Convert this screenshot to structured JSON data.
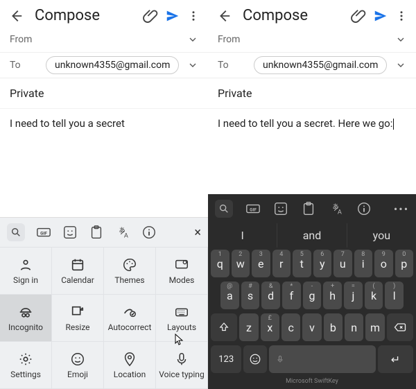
{
  "left": {
    "header": {
      "title": "Compose"
    },
    "from_label": "From",
    "to_label": "To",
    "to_value": "unknown4355@gmail.com",
    "subject": "Private",
    "body": "I need to tell you a secret",
    "kb": {
      "grid": [
        {
          "label": "Sign in",
          "icon": "person"
        },
        {
          "label": "Calendar",
          "icon": "calendar"
        },
        {
          "label": "Themes",
          "icon": "palette"
        },
        {
          "label": "Modes",
          "icon": "modes"
        },
        {
          "label": "Incognito",
          "icon": "incognito",
          "selected": true
        },
        {
          "label": "Resize",
          "icon": "resize"
        },
        {
          "label": "Autocorrect",
          "icon": "autocorrect"
        },
        {
          "label": "Layouts",
          "icon": "keyboard"
        },
        {
          "label": "Settings",
          "icon": "gear"
        },
        {
          "label": "Emoji",
          "icon": "emoji"
        },
        {
          "label": "Location",
          "icon": "pin"
        },
        {
          "label": "Voice typing",
          "icon": "mic"
        }
      ]
    }
  },
  "right": {
    "header": {
      "title": "Compose"
    },
    "from_label": "From",
    "to_label": "To",
    "to_value": "unknown4355@gmail.com",
    "subject": "Private",
    "body": "I need to tell you a secret. Here we go:",
    "kb": {
      "suggestions": [
        "I",
        "and",
        "you"
      ],
      "rows": [
        [
          {
            "k": "q",
            "a": "1"
          },
          {
            "k": "w",
            "a": "2"
          },
          {
            "k": "e",
            "a": "3"
          },
          {
            "k": "r",
            "a": "4"
          },
          {
            "k": "t",
            "a": "5"
          },
          {
            "k": "y",
            "a": "6"
          },
          {
            "k": "u",
            "a": "7"
          },
          {
            "k": "i",
            "a": "8"
          },
          {
            "k": "o",
            "a": "9"
          },
          {
            "k": "p",
            "a": "0"
          }
        ],
        [
          {
            "k": "a",
            "a": "@"
          },
          {
            "k": "s",
            "a": "#"
          },
          {
            "k": "d",
            "a": "&"
          },
          {
            "k": "f",
            "a": "*"
          },
          {
            "k": "g",
            "a": "-"
          },
          {
            "k": "h",
            "a": "+"
          },
          {
            "k": "j",
            "a": "="
          },
          {
            "k": "k",
            "a": "("
          },
          {
            "k": "l",
            "a": ")"
          }
        ],
        [
          {
            "k": "z",
            "a": ""
          },
          {
            "k": "x",
            "a": "£"
          },
          {
            "k": "c",
            "a": ""
          },
          {
            "k": "v",
            "a": ""
          },
          {
            "k": "b",
            "a": ""
          },
          {
            "k": "n",
            "a": ""
          },
          {
            "k": "m",
            "a": ""
          }
        ]
      ],
      "brand": "Microsoft SwiftKey",
      "numeric_label": "123"
    }
  }
}
